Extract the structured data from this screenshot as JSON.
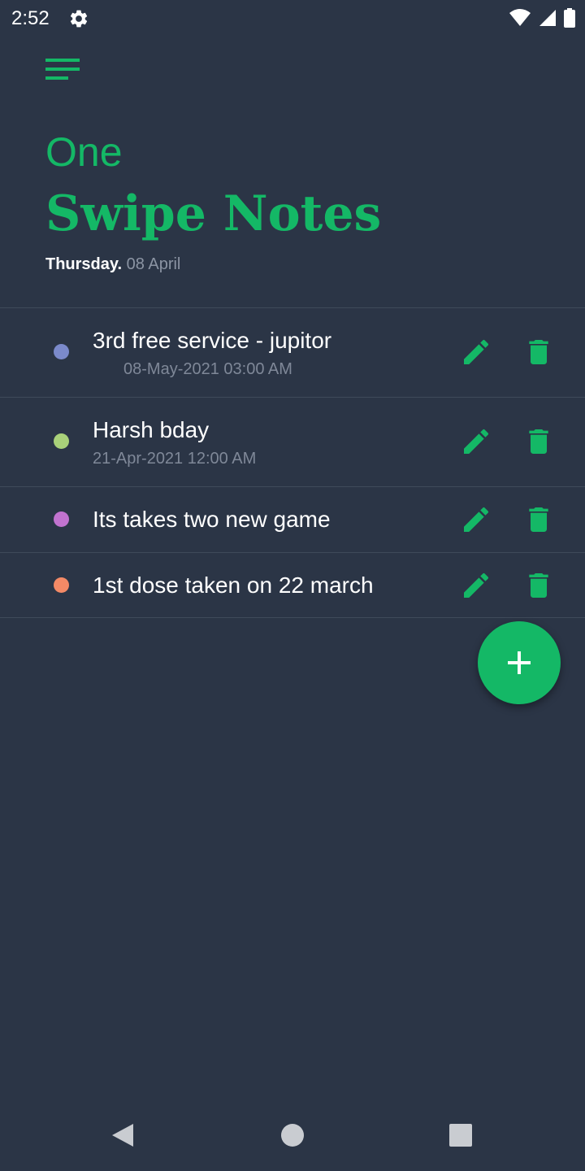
{
  "status_bar": {
    "time": "2:52"
  },
  "header": {
    "title_small": "One",
    "title_large": "Swipe Notes",
    "date_day": "Thursday.",
    "date_rest": "08 April"
  },
  "notes": [
    {
      "title": "3rd free service - jupitor",
      "subtitle": "08-May-2021 03:00 AM",
      "dot_color": "#7b8acb"
    },
    {
      "title": "Harsh bday",
      "subtitle": "21-Apr-2021 12:00 AM",
      "dot_color": "#a9d17a"
    },
    {
      "title": "Its takes two new game",
      "subtitle": "",
      "dot_color": "#c173cf"
    },
    {
      "title": "1st dose taken on 22 march",
      "subtitle": "",
      "dot_color": "#f48a66"
    }
  ],
  "colors": {
    "accent": "#14b866",
    "background": "#2b3546",
    "divider": "#3f4a5a",
    "muted_text": "#7f8898"
  },
  "icons": {
    "menu": "menu-icon",
    "edit": "pencil-icon",
    "delete": "trash-icon",
    "add": "plus-icon"
  }
}
